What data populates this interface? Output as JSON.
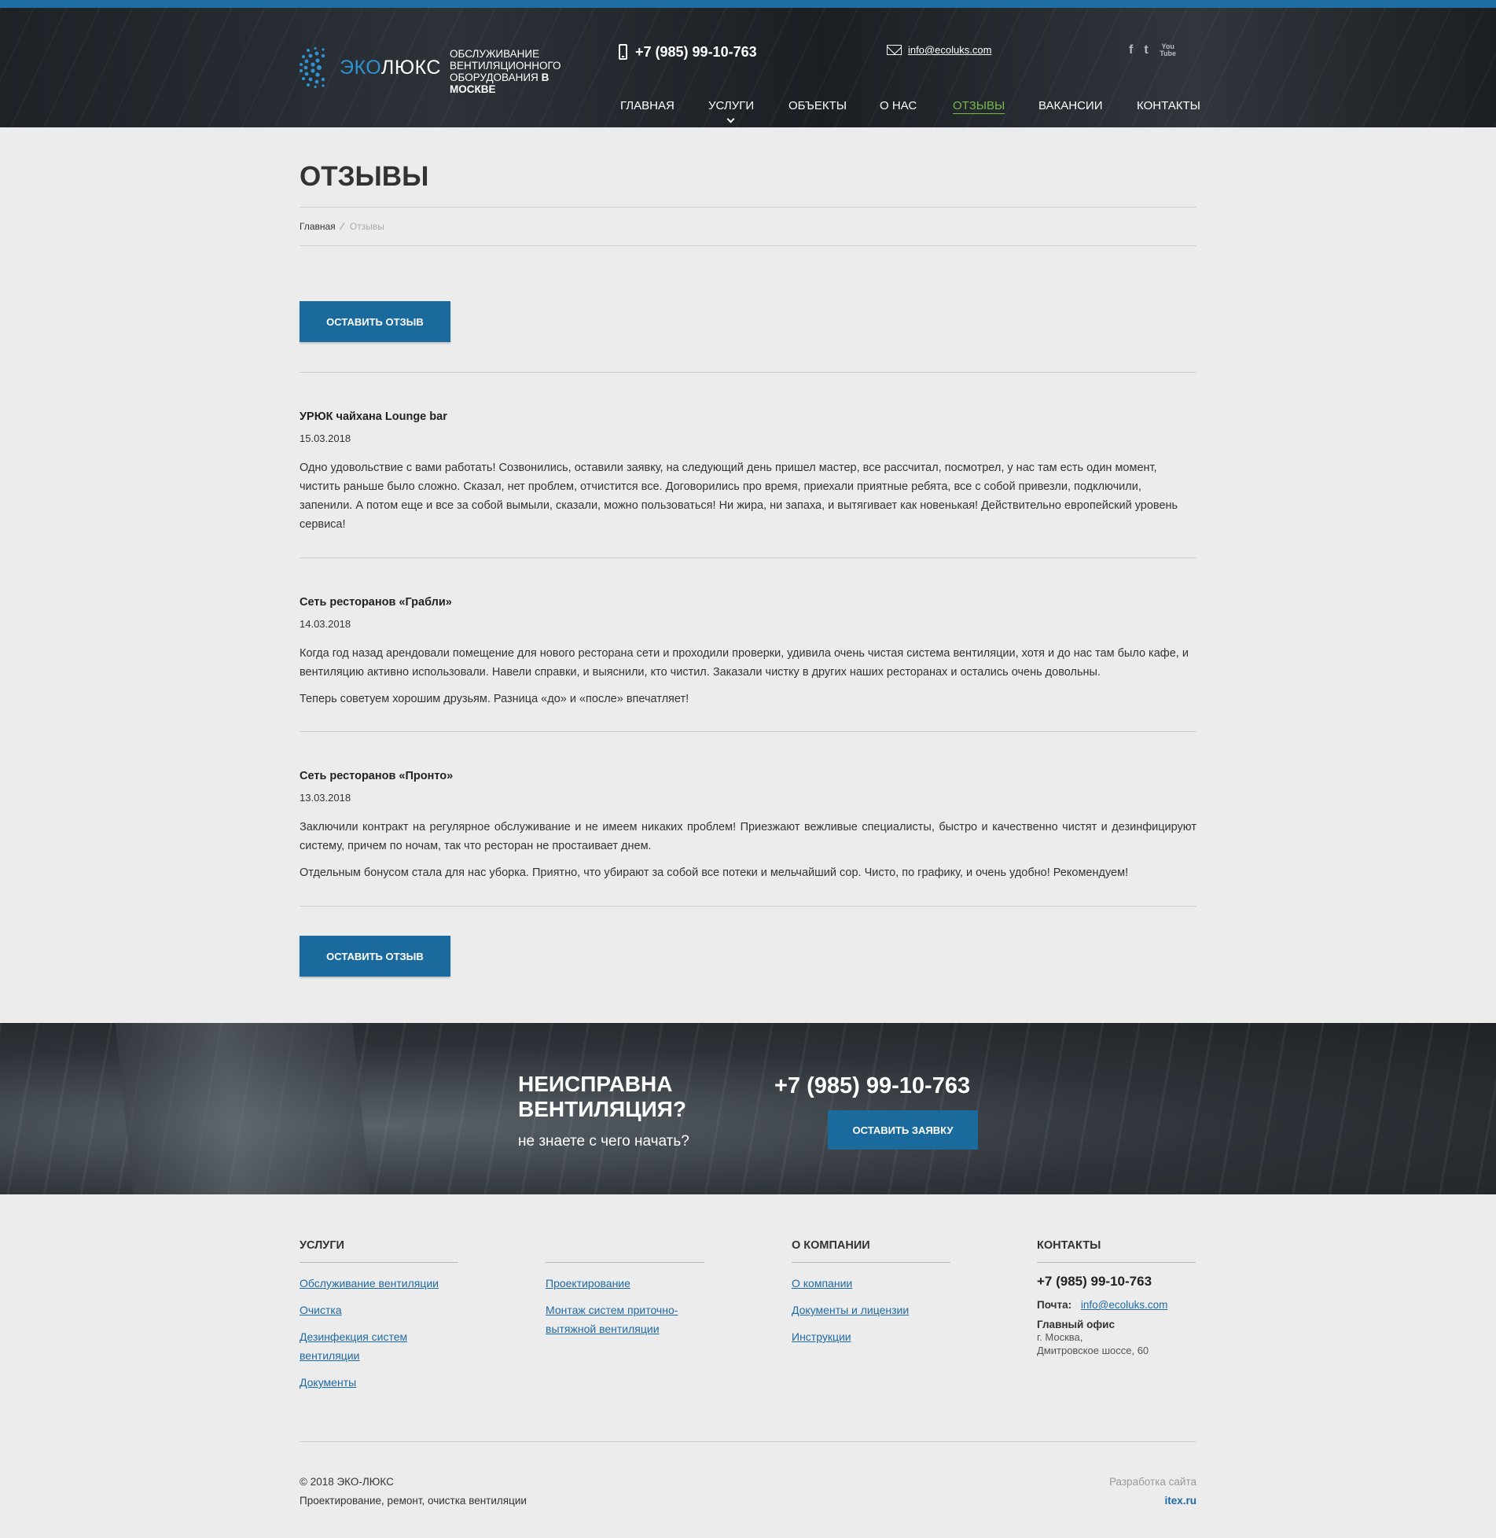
{
  "header": {
    "logo": {
      "part1": "ЭКО",
      "part2": "ЛЮКС"
    },
    "tagline": {
      "line": "ОБСЛУЖИВАНИЕ ВЕНТИЛЯЦИОННОГО ОБОРУДОВАНИЯ",
      "bold": "В МОСКВЕ"
    },
    "phone": "+7 (985) 99-10-763",
    "email": "info@ecoluks.com",
    "social": {
      "facebook": "f",
      "twitter": "t",
      "youtube": "You Tube"
    }
  },
  "nav": {
    "items": [
      {
        "label": "ГЛАВНАЯ"
      },
      {
        "label": "УСЛУГИ"
      },
      {
        "label": "ОБЪЕКТЫ"
      },
      {
        "label": "О НАС"
      },
      {
        "label": "ОТЗЫВЫ"
      },
      {
        "label": "ВАКАНСИИ"
      },
      {
        "label": "КОНТАКТЫ"
      }
    ],
    "active_color": "#79b94a"
  },
  "page": {
    "title": "ОТЗЫВЫ",
    "breadcrumb": {
      "home": "Главная",
      "current": "Отзывы"
    },
    "leave_review_label": "ОСТАВИТЬ ОТЗЫВ"
  },
  "reviews": [
    {
      "name": "УРЮК чайхана Lounge bar",
      "date": "15.03.2018",
      "paragraphs": [
        "Одно удовольствие с вами работать! Созвонились, оставили заявку, на следующий день пришел мастер, все рассчитал, посмотрел, у нас там есть один момент, чистить раньше было сложно. Сказал, нет проблем, отчистится все. Договорились про время, приехали приятные ребята, все с собой привезли, подключили, запенили. А потом еще и все за собой вымыли, сказали, можно пользоваться! Ни жира, ни запаха, и вытягивает как новенькая! Действительно европейский уровень сервиса!"
      ]
    },
    {
      "name": "Сеть ресторанов «Грабли»",
      "date": "14.03.2018",
      "paragraphs": [
        "Когда год назад арендовали помещение для нового ресторана сети и проходили проверки, удивила очень чистая система вентиляции, хотя и до нас там было кафе, и вентиляцию активно использовали. Навели справки, и выяснили, кто чистил. Заказали чистку в других наших ресторанах и остались очень довольны.",
        "Теперь советуем хорошим друзьям. Разница «до» и «после» впечатляет!"
      ]
    },
    {
      "name": "Сеть ресторанов «Пронто»",
      "date": "13.03.2018",
      "paragraphs": [
        "Заключили контракт на регулярное обслуживание и не имеем никаких проблем! Приезжают вежливые специалисты, быстро и качественно чистят и дезинфицируют систему, причем по ночам, так что ресторан не простаивает днем.",
        "Отдельным бонусом стала для нас уборка. Приятно, что убирают за собой все потеки и мельчайший сор. Чисто, по графику, и очень удобно! Рекомендуем!"
      ]
    }
  ],
  "cta": {
    "title": "НЕИСПРАВНА ВЕНТИЛЯЦИЯ?",
    "subtitle": "не знаете с чего начать?",
    "phone": "+7 (985) 99-10-763",
    "button_label": "ОСТАВИТЬ ЗАЯВКУ"
  },
  "footer": {
    "services": {
      "title": "УСЛУГИ",
      "links": [
        "Обслуживание вентиляции",
        "Очистка",
        "Дезинфекция систем вентиляции",
        "Документы"
      ]
    },
    "services2": {
      "links": [
        "Проектирование",
        "Монтаж систем приточно-вытяжной вентиляции"
      ]
    },
    "company": {
      "title": "О КОМПАНИИ",
      "links": [
        "О компании",
        "Документы и лицензии",
        "Инструкции"
      ]
    },
    "contacts": {
      "title": "КОНТАКТЫ",
      "phone": "+7 (985) 99-10-763",
      "mail_label": "Почта:",
      "email": "info@ecoluks.com",
      "office_label": "Главный офис",
      "address_line1": "г. Москва,",
      "address_line2": "Дмитровское шоссе, 60"
    },
    "copyright": "© 2018 ЭКО-ЛЮКС",
    "copyright_sub": "Проектирование, ремонт, очистка вентиляции",
    "dev_label": "Разработка сайта",
    "dev_link": "itex.ru"
  },
  "colors": {
    "accent": "#1a6a9d",
    "topbar": "#1f6ea3",
    "link": "#1e6aa4",
    "background": "#ececec"
  }
}
